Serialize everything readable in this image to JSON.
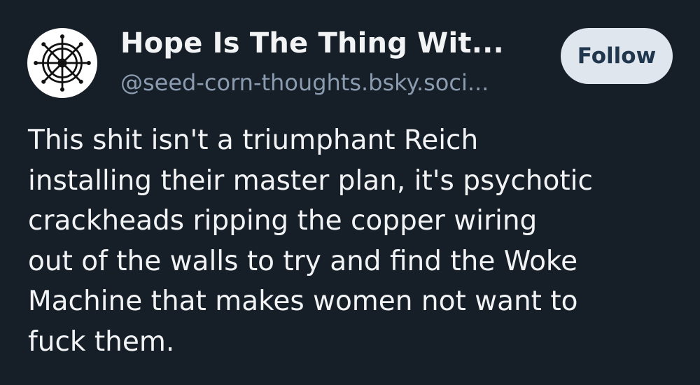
{
  "author": {
    "display_name": "Hope Is The Thing Wit...",
    "handle": "@seed-corn-thoughts.bsky.soci...",
    "avatar_icon": "ship-wheel-icon"
  },
  "actions": {
    "follow_label": "Follow"
  },
  "post": {
    "text": "This shit isn't a triumphant Reich\ninstalling their master plan, it's psychotic\ncrackheads ripping the copper wiring\nout of the walls to try and find the Woke\nMachine that makes women not want to\nfuck them."
  },
  "colors": {
    "background": "#161e27",
    "primary_text": "#f1f3f5",
    "secondary_text": "#8c9cb0",
    "follow_button_bg": "#dfe6ee",
    "follow_button_text": "#20364d"
  }
}
